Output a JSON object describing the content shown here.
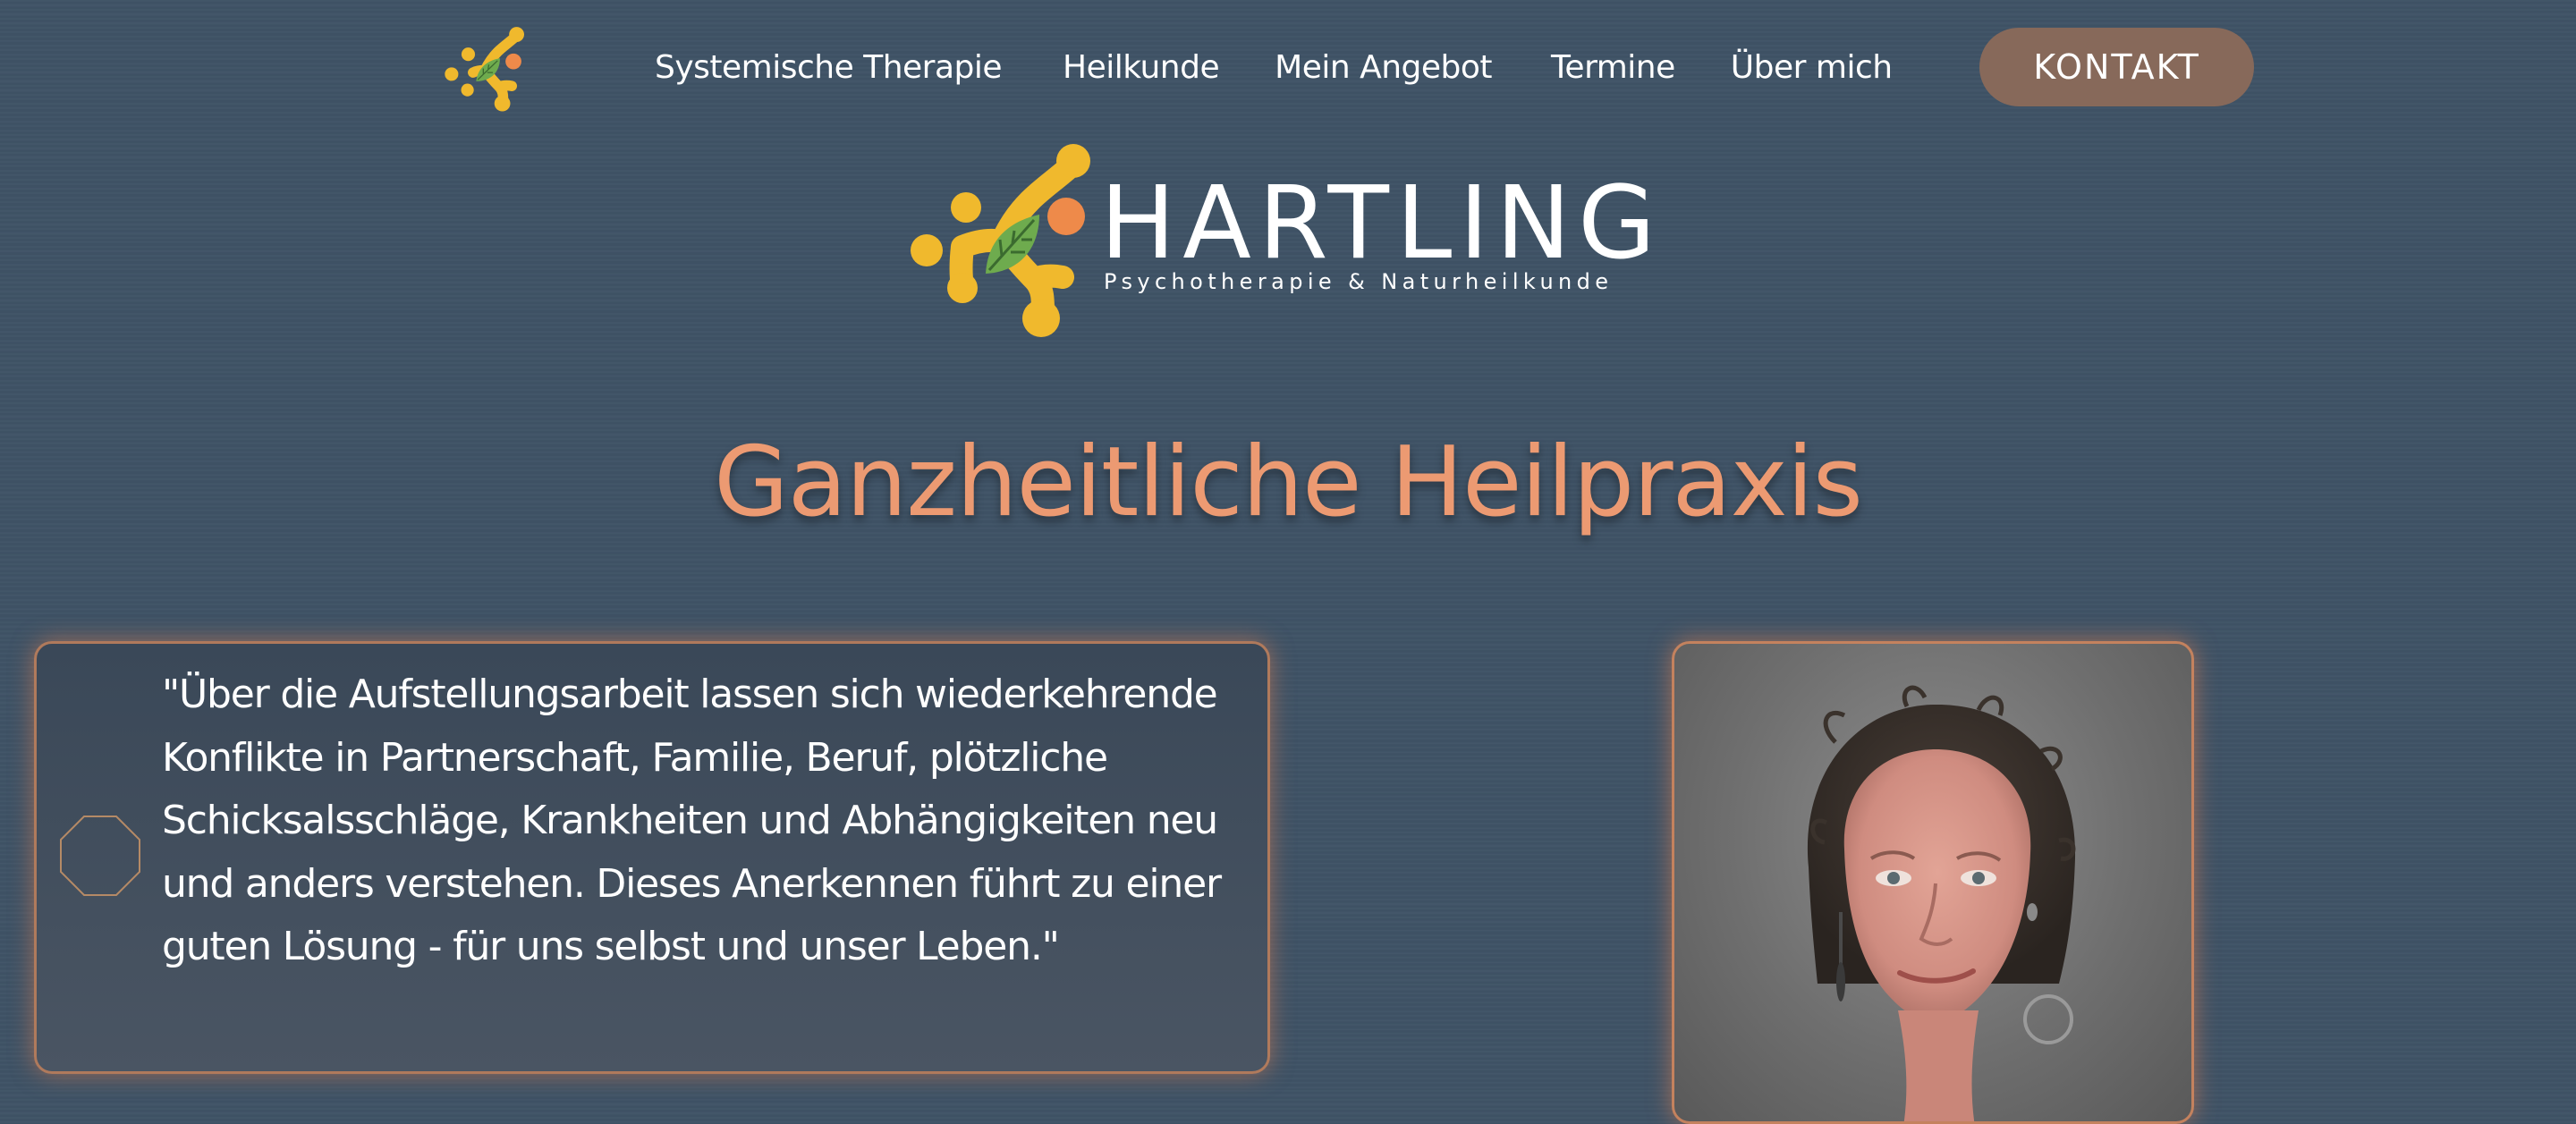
{
  "nav": {
    "logo_icon": "hartling-logo-mark",
    "links": [
      {
        "label": "Systemische Therapie"
      },
      {
        "label": "Heilkunde"
      },
      {
        "label": "Mein Angebot"
      },
      {
        "label": "Termine"
      },
      {
        "label": "Über mich"
      }
    ],
    "contact_button": "KONTAKT"
  },
  "brand": {
    "name": "HARTLING",
    "tagline": "Psychotherapie & Naturheilkunde",
    "icon": "leaf-molecule-logo"
  },
  "headline": "Ganzheitliche Heilpraxis",
  "quote": {
    "icon": "octagon-icon",
    "text": "\"Über die Aufstellungsarbeit lassen sich wiederkehrende Konflikte in Partnerschaft, Familie, Beruf, plötzliche Schicksalsschläge, Krankheiten und Abhängigkeiten neu und anders verstehen. Dieses Anerkennen führt zu einer guten Lösung - für uns selbst und unser Leben.\""
  },
  "portrait": {
    "subject": "portrait-photo"
  },
  "colors": {
    "background": "#3f5366",
    "accent_orange": "#ec9a72",
    "button_brown": "#87695a",
    "logo_yellow": "#f0b92d",
    "logo_orange": "#ee8a4a",
    "logo_leaf_green": "#6eab4e"
  }
}
